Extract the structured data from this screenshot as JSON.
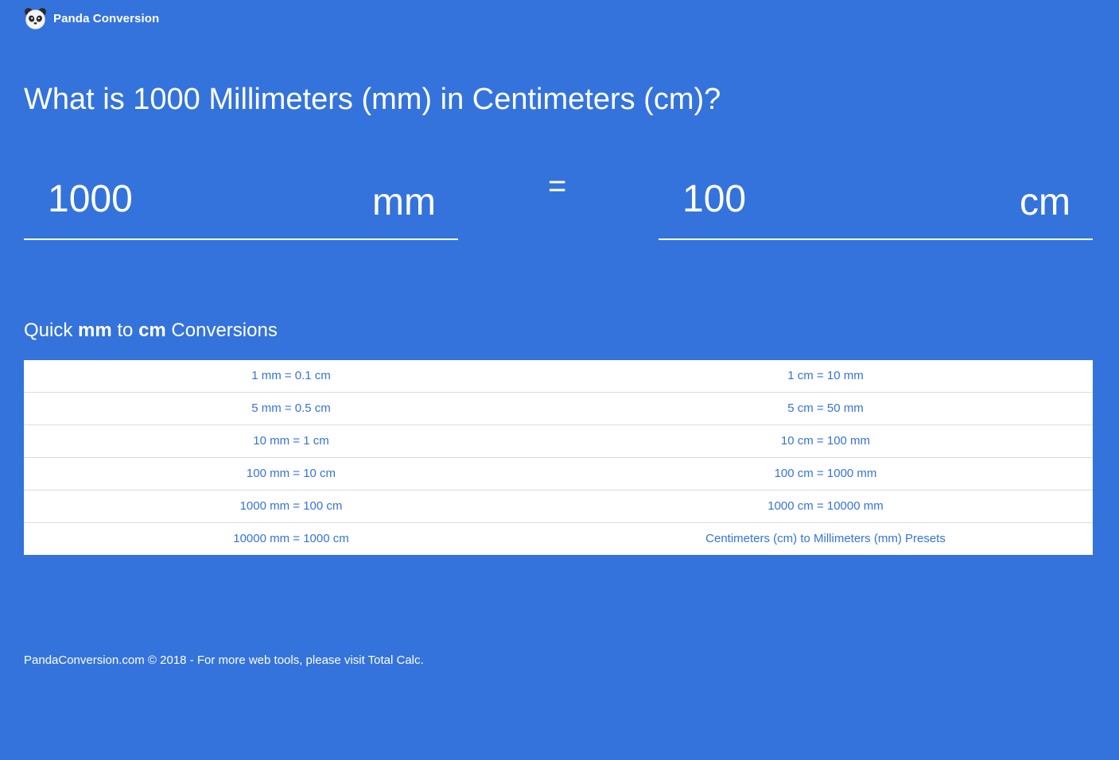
{
  "header": {
    "brand_name": "Panda Conversion",
    "logo_icon": "panda-icon"
  },
  "title": "What is 1000 Millimeters (mm) in Centimeters (cm)?",
  "converter": {
    "from_value": "1000",
    "from_unit": "mm",
    "equals": "=",
    "to_value": "100",
    "to_unit": "cm"
  },
  "quick": {
    "prefix": "Quick ",
    "from_unit": "mm",
    "middle": " to ",
    "to_unit": "cm",
    "suffix": " Conversions"
  },
  "table": {
    "rows": [
      {
        "left": "1 mm = 0.1 cm",
        "right": "1 cm = 10 mm"
      },
      {
        "left": "5 mm = 0.5 cm",
        "right": "5 cm = 50 mm"
      },
      {
        "left": "10 mm = 1 cm",
        "right": "10 cm = 100 mm"
      },
      {
        "left": "100 mm = 10 cm",
        "right": "100 cm = 1000 mm"
      },
      {
        "left": "1000 mm = 100 cm",
        "right": "1000 cm = 10000 mm"
      },
      {
        "left": "10000 mm = 1000 cm",
        "right": "Centimeters (cm) to Millimeters (mm) Presets"
      }
    ]
  },
  "footer": {
    "text": "PandaConversion.com © 2018 - For more web tools, please visit ",
    "link": "Total Calc",
    "end": "."
  },
  "colors": {
    "background": "#3473dc",
    "text": "#ffffff",
    "table_bg": "#ffffff",
    "table_text": "#3473dc"
  }
}
